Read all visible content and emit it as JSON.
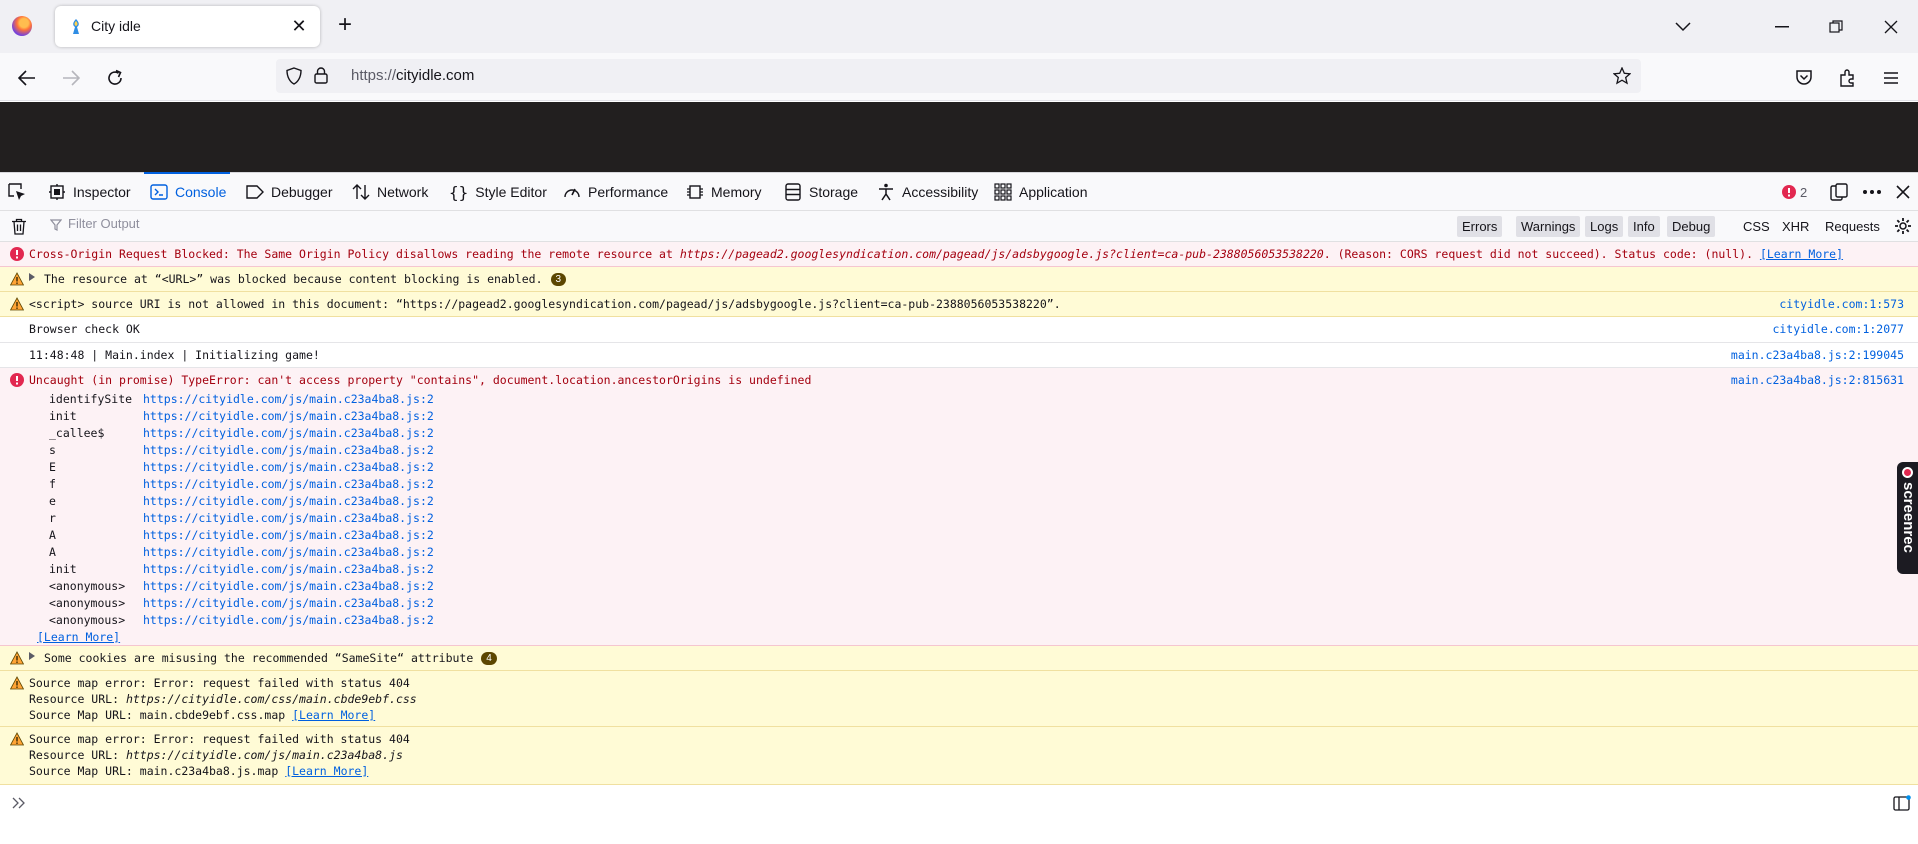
{
  "browser": {
    "tab_title": "City idle",
    "url_scheme": "https://",
    "url_host": "cityidle.com"
  },
  "devtools": {
    "tools": [
      "Inspector",
      "Console",
      "Debugger",
      "Network",
      "Style Editor",
      "Performance",
      "Memory",
      "Storage",
      "Accessibility",
      "Application"
    ],
    "error_count": "2",
    "filter_placeholder": "Filter Output",
    "filters": [
      "Errors",
      "Warnings",
      "Logs",
      "Info",
      "Debug"
    ],
    "extra_filters": [
      "CSS",
      "XHR",
      "Requests"
    ]
  },
  "console": {
    "m1": {
      "pre": "Cross-Origin Request Blocked: The Same Origin Policy disallows reading the remote resource at ",
      "url": "https://pagead2.googlesyndication.com/pagead/js/adsbygoogle.js?client=ca-pub-2388056053538220",
      "post": ". (Reason: CORS request did not succeed). Status code: (null).",
      "learn": "[Learn More]"
    },
    "m2": {
      "text": "The resource at “<URL>” was blocked because content blocking is enabled.",
      "count": "3"
    },
    "m3": {
      "text": "<script> source URI is not allowed in this document: “https://pagead2.googlesyndication.com/pagead/js/adsbygoogle.js?client=ca-pub-2388056053538220”.",
      "source": "cityidle.com:1:573"
    },
    "m4": {
      "text": "Browser check OK",
      "source": "cityidle.com:1:2077"
    },
    "m5": {
      "text": "11:48:48 | Main.index | Initializing game!",
      "source": "main.c23a4ba8.js:2:199045"
    },
    "m6": {
      "text": "Uncaught (in promise) TypeError: can't access property \"contains\", document.location.ancestorOrigins is undefined",
      "source": "main.c23a4ba8.js:2:815631",
      "stack": [
        {
          "fn": "identifySite",
          "url": "https://cityidle.com/js/main.c23a4ba8.js:2"
        },
        {
          "fn": "init",
          "url": "https://cityidle.com/js/main.c23a4ba8.js:2"
        },
        {
          "fn": "_callee$",
          "url": "https://cityidle.com/js/main.c23a4ba8.js:2"
        },
        {
          "fn": "s",
          "url": "https://cityidle.com/js/main.c23a4ba8.js:2"
        },
        {
          "fn": "E",
          "url": "https://cityidle.com/js/main.c23a4ba8.js:2"
        },
        {
          "fn": "f",
          "url": "https://cityidle.com/js/main.c23a4ba8.js:2"
        },
        {
          "fn": "e",
          "url": "https://cityidle.com/js/main.c23a4ba8.js:2"
        },
        {
          "fn": "r",
          "url": "https://cityidle.com/js/main.c23a4ba8.js:2"
        },
        {
          "fn": "A",
          "url": "https://cityidle.com/js/main.c23a4ba8.js:2"
        },
        {
          "fn": "A",
          "url": "https://cityidle.com/js/main.c23a4ba8.js:2"
        },
        {
          "fn": "init",
          "url": "https://cityidle.com/js/main.c23a4ba8.js:2"
        },
        {
          "fn": "<anonymous>",
          "url": "https://cityidle.com/js/main.c23a4ba8.js:2"
        },
        {
          "fn": "<anonymous>",
          "url": "https://cityidle.com/js/main.c23a4ba8.js:2"
        },
        {
          "fn": "<anonymous>",
          "url": "https://cityidle.com/js/main.c23a4ba8.js:2"
        }
      ],
      "learn": "[Learn More]"
    },
    "m7": {
      "text": "Some cookies are misusing the recommended “SameSite“ attribute",
      "count": "4"
    },
    "m8": {
      "line1": "Source map error: Error: request failed with status 404",
      "line2_label": "Resource URL: ",
      "line2_url": "https://cityidle.com/css/main.cbde9ebf.css",
      "line3": "Source Map URL: main.cbde9ebf.css.map ",
      "learn": "[Learn More]"
    },
    "m9": {
      "line1": "Source map error: Error: request failed with status 404",
      "line2_label": "Resource URL: ",
      "line2_url": "https://cityidle.com/js/main.c23a4ba8.js",
      "line3": "Source Map URL: main.c23a4ba8.js.map ",
      "learn": "[Learn More]"
    }
  },
  "overlay": {
    "screenrec": "screenrec"
  },
  "colors": {
    "accent": "#0060df",
    "error": "#a4000f",
    "warning_bg": "#fffbd6",
    "error_bg": "#fdf2f5"
  }
}
